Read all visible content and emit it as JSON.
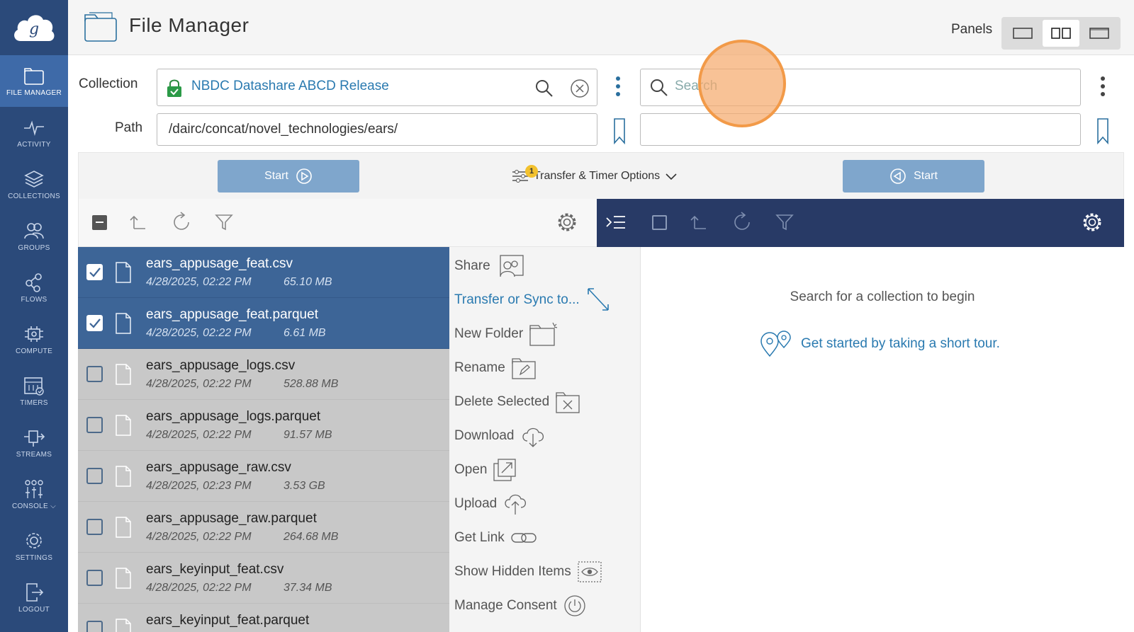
{
  "header": {
    "title": "File Manager",
    "panels_label": "Panels"
  },
  "sidebar": {
    "items": [
      {
        "label": "FILE MANAGER",
        "icon": "file-manager-icon"
      },
      {
        "label": "ACTIVITY",
        "icon": "activity-icon"
      },
      {
        "label": "COLLECTIONS",
        "icon": "collections-icon"
      },
      {
        "label": "GROUPS",
        "icon": "groups-icon"
      },
      {
        "label": "FLOWS",
        "icon": "flows-icon"
      },
      {
        "label": "COMPUTE",
        "icon": "compute-icon"
      },
      {
        "label": "TIMERS",
        "icon": "timers-icon"
      },
      {
        "label": "STREAMS",
        "icon": "streams-icon"
      },
      {
        "label": "CONSOLE ⌵",
        "icon": "console-icon"
      },
      {
        "label": "SETTINGS",
        "icon": "settings-icon"
      },
      {
        "label": "LOGOUT",
        "icon": "logout-icon"
      }
    ]
  },
  "left_panel": {
    "collection_label": "Collection",
    "collection_value": "NBDC Datashare ABCD Release",
    "path_label": "Path",
    "path_value": "/dairc/concat/novel_technologies/ears/"
  },
  "right_panel": {
    "search_placeholder": "Search",
    "path_value": "",
    "empty_message": "Search for a collection to begin",
    "tour_link": "Get started by taking a short tour."
  },
  "transfer": {
    "start_left": "Start",
    "start_right": "Start",
    "options_label": "Transfer & Timer Options",
    "options_badge": "1"
  },
  "files": [
    {
      "name": "ears_appusage_feat.csv",
      "date": "4/28/2025, 02:22 PM",
      "size": "65.10 MB",
      "selected": true
    },
    {
      "name": "ears_appusage_feat.parquet",
      "date": "4/28/2025, 02:22 PM",
      "size": "6.61 MB",
      "selected": true
    },
    {
      "name": "ears_appusage_logs.csv",
      "date": "4/28/2025, 02:22 PM",
      "size": "528.88 MB",
      "selected": false
    },
    {
      "name": "ears_appusage_logs.parquet",
      "date": "4/28/2025, 02:22 PM",
      "size": "91.57 MB",
      "selected": false
    },
    {
      "name": "ears_appusage_raw.csv",
      "date": "4/28/2025, 02:23 PM",
      "size": "3.53 GB",
      "selected": false
    },
    {
      "name": "ears_appusage_raw.parquet",
      "date": "4/28/2025, 02:22 PM",
      "size": "264.68 MB",
      "selected": false
    },
    {
      "name": "ears_keyinput_feat.csv",
      "date": "4/28/2025, 02:22 PM",
      "size": "37.34 MB",
      "selected": false
    },
    {
      "name": "ears_keyinput_feat.parquet",
      "date": "",
      "size": "",
      "selected": false
    }
  ],
  "actions": [
    {
      "label": "Share",
      "icon": "share-icon"
    },
    {
      "label": "Transfer or Sync to...",
      "icon": "transfer-arrow-icon"
    },
    {
      "label": "New Folder",
      "icon": "new-folder-icon"
    },
    {
      "label": "Rename",
      "icon": "rename-icon"
    },
    {
      "label": "Delete Selected",
      "icon": "delete-icon"
    },
    {
      "label": "Download",
      "icon": "download-icon"
    },
    {
      "label": "Open",
      "icon": "open-external-icon"
    },
    {
      "label": "Upload",
      "icon": "upload-icon"
    },
    {
      "label": "Get Link",
      "icon": "link-icon"
    },
    {
      "label": "Show Hidden Items",
      "icon": "eye-icon"
    },
    {
      "label": "Manage Consent",
      "icon": "power-icon"
    }
  ],
  "colors": {
    "sidebar": "#2b4a7a",
    "sidebar_active": "#3e6aa8",
    "selected_row": "#3d6597",
    "right_toolbar": "#283a66",
    "link": "#2a7ab0",
    "start_button": "#7fa6cc",
    "highlight": "#f29a48"
  }
}
